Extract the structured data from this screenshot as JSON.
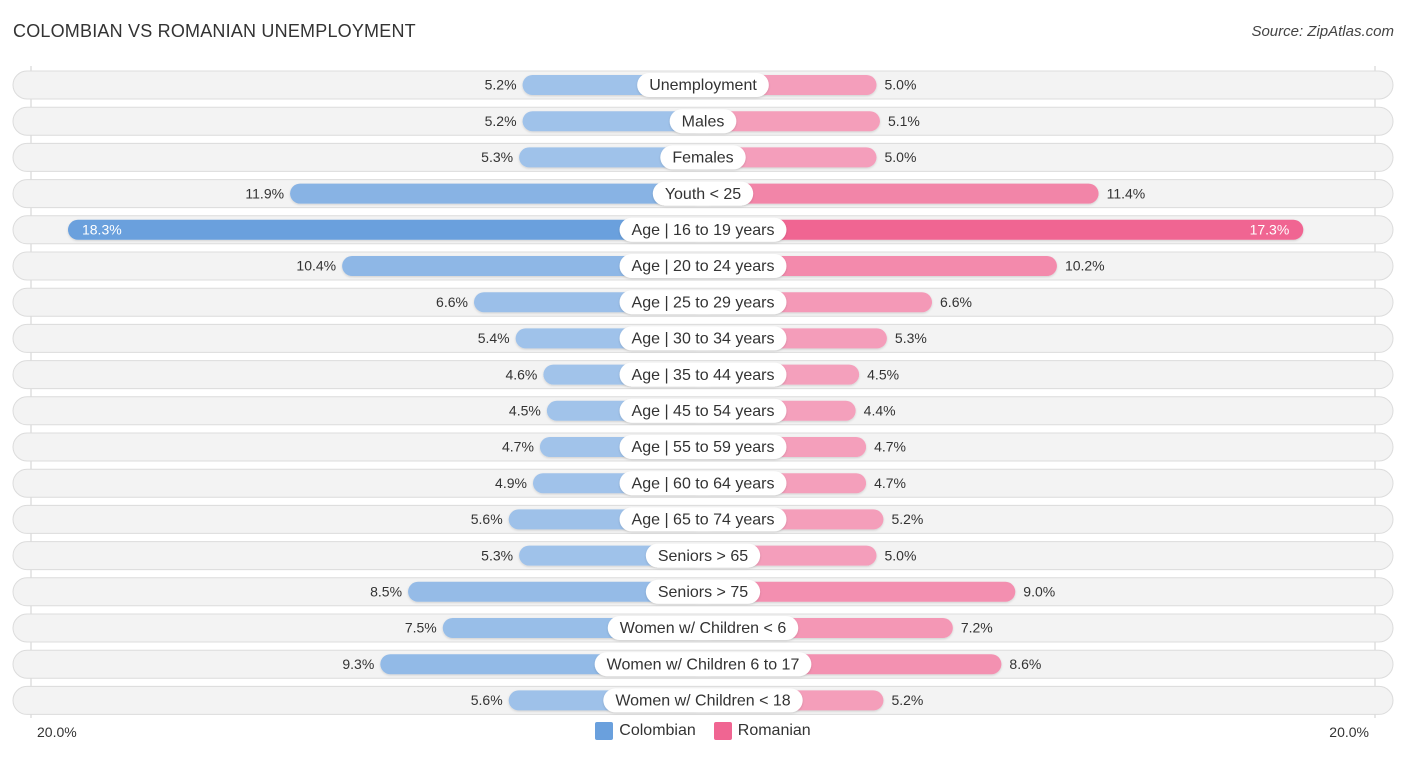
{
  "header": {
    "title": "COLOMBIAN VS ROMANIAN UNEMPLOYMENT",
    "source": "Source: ZipAtlas.com"
  },
  "colors": {
    "colombian": "#6aa0dd",
    "colombian_light": "#a9c8ec",
    "romanian": "#f06592",
    "romanian_light": "#f5a9c2"
  },
  "chart_data": {
    "type": "bar",
    "orientation": "horizontal-diverging",
    "title": "COLOMBIAN VS ROMANIAN UNEMPLOYMENT",
    "xlabel": "",
    "ylabel": "",
    "xlim": [
      -20,
      20
    ],
    "axis_left_label": "20.0%",
    "axis_right_label": "20.0%",
    "legend_position": "bottom-center",
    "categories": [
      "Unemployment",
      "Males",
      "Females",
      "Youth < 25",
      "Age | 16 to 19 years",
      "Age | 20 to 24 years",
      "Age | 25 to 29 years",
      "Age | 30 to 34 years",
      "Age | 35 to 44 years",
      "Age | 45 to 54 years",
      "Age | 55 to 59 years",
      "Age | 60 to 64 years",
      "Age | 65 to 74 years",
      "Seniors > 65",
      "Seniors > 75",
      "Women w/ Children < 6",
      "Women w/ Children 6 to 17",
      "Women w/ Children < 18"
    ],
    "series": [
      {
        "name": "Colombian",
        "side": "left",
        "values": [
          5.2,
          5.2,
          5.3,
          11.9,
          18.3,
          10.4,
          6.6,
          5.4,
          4.6,
          4.5,
          4.7,
          4.9,
          5.6,
          5.3,
          8.5,
          7.5,
          9.3,
          5.6
        ],
        "labels": [
          "5.2%",
          "5.2%",
          "5.3%",
          "11.9%",
          "18.3%",
          "10.4%",
          "6.6%",
          "5.4%",
          "4.6%",
          "4.5%",
          "4.7%",
          "4.9%",
          "5.6%",
          "5.3%",
          "8.5%",
          "7.5%",
          "9.3%",
          "5.6%"
        ]
      },
      {
        "name": "Romanian",
        "side": "right",
        "values": [
          5.0,
          5.1,
          5.0,
          11.4,
          17.3,
          10.2,
          6.6,
          5.3,
          4.5,
          4.4,
          4.7,
          4.7,
          5.2,
          5.0,
          9.0,
          7.2,
          8.6,
          5.2
        ],
        "labels": [
          "5.0%",
          "5.1%",
          "5.0%",
          "11.4%",
          "17.3%",
          "10.2%",
          "6.6%",
          "5.3%",
          "4.5%",
          "4.4%",
          "4.7%",
          "4.7%",
          "5.2%",
          "5.0%",
          "9.0%",
          "7.2%",
          "8.6%",
          "5.2%"
        ]
      }
    ]
  },
  "legend": {
    "items": [
      {
        "label": "Colombian"
      },
      {
        "label": "Romanian"
      }
    ]
  }
}
